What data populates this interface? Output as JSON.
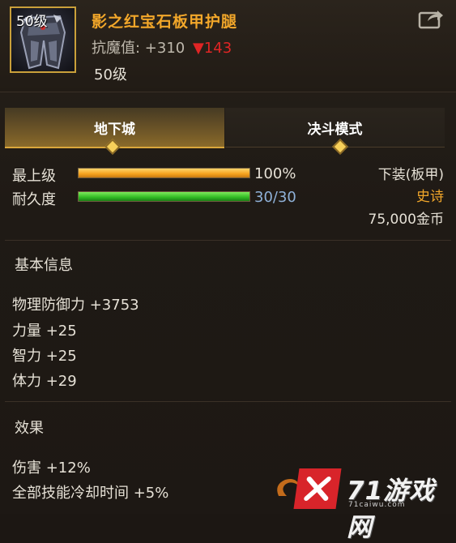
{
  "item": {
    "icon_level": "50级",
    "name": "影之红宝石板甲护腿",
    "stat_label": "抗魔值: +310",
    "stat_down_arrow": "▼",
    "stat_down_value": "143",
    "required_level": "50级"
  },
  "tabs": [
    {
      "label": "地下城",
      "active": true
    },
    {
      "label": "决斗模式",
      "active": false
    }
  ],
  "bars": [
    {
      "label": "最上级",
      "value_text": "100%",
      "fraction": 1.0,
      "color": "#f5a11d"
    },
    {
      "label": "耐久度",
      "value_text": "30/30",
      "fraction": 1.0,
      "color": "#2fb923"
    }
  ],
  "meta": {
    "slot": "下装(板甲)",
    "rarity": "史诗",
    "rarity_color": "#f2a72a",
    "price": "75,000金币"
  },
  "basic_info": {
    "title": "基本信息",
    "lines": [
      "物理防御力 +3753",
      "力量 +25",
      "智力 +25",
      "体力 +29"
    ]
  },
  "effects": {
    "title": "效果",
    "lines": [
      "伤害 +12%",
      "全部技能冷却时间 +5%"
    ]
  },
  "watermark": {
    "text": "71游戏网",
    "url": "71caiwu.com"
  },
  "icons": [
    "share-icon",
    "item-icon",
    "tab-diamond-icon"
  ]
}
